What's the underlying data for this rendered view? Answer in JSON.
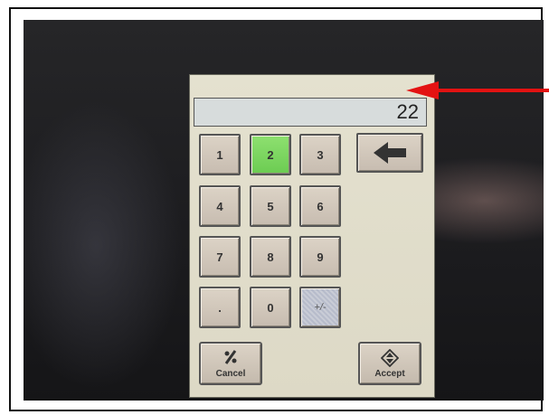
{
  "display": {
    "value": "22"
  },
  "keypad": {
    "keys": [
      {
        "label": "1"
      },
      {
        "label": "2"
      },
      {
        "label": "3"
      },
      {
        "label": "4"
      },
      {
        "label": "5"
      },
      {
        "label": "6"
      },
      {
        "label": "7"
      },
      {
        "label": "8"
      },
      {
        "label": "9"
      },
      {
        "label": "."
      },
      {
        "label": "0"
      },
      {
        "label": "+/-"
      }
    ],
    "active_key": "2",
    "backspace_icon": "arrow-left-icon"
  },
  "actions": {
    "cancel_label": "Cancel",
    "cancel_icon": "percent-icon",
    "accept_label": "Accept",
    "accept_icon": "diamond-arrows-icon"
  },
  "annotation": {
    "color": "#e31212"
  },
  "colors": {
    "active_key": "#7dd860",
    "display_bg": "#d7dcdc"
  }
}
